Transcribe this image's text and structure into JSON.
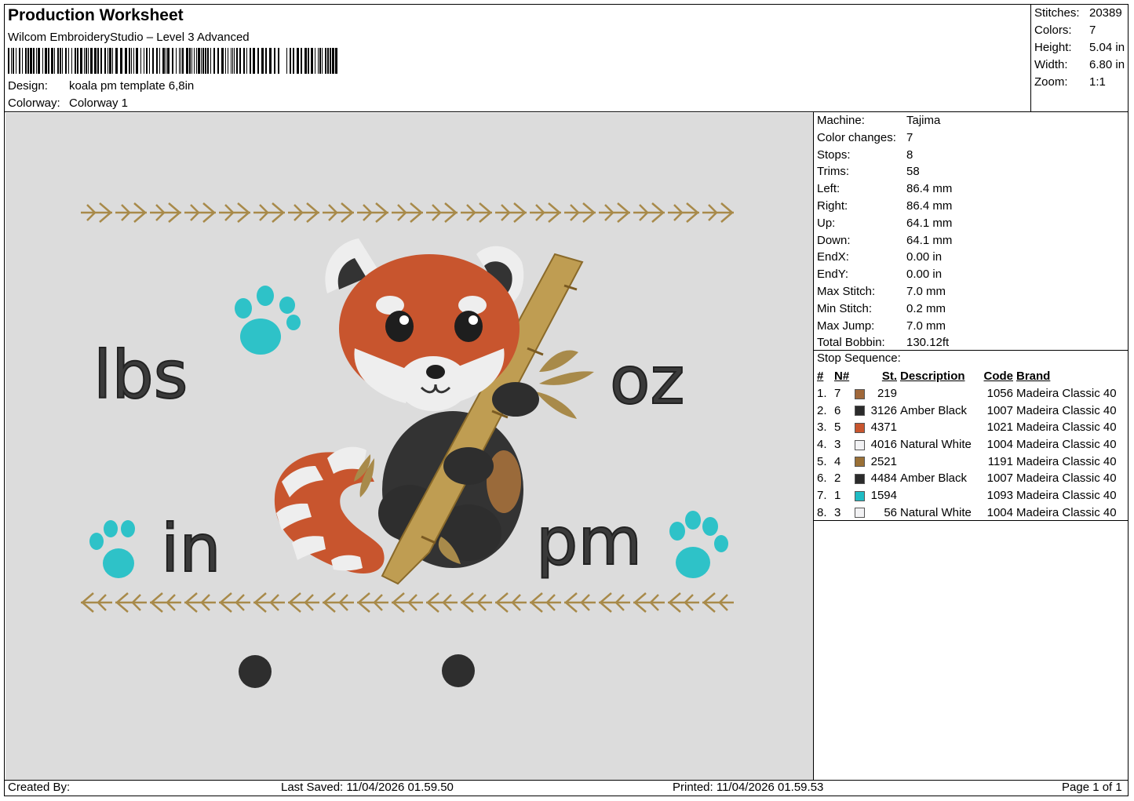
{
  "header": {
    "title": "Production Worksheet",
    "software": "Wilcom EmbroideryStudio – Level 3 Advanced",
    "design_label": "Design:",
    "design_value": "koala pm template 6,8in",
    "colorway_label": "Colorway:",
    "colorway_value": "Colorway 1"
  },
  "summary": [
    {
      "label": "Stitches:",
      "value": "20389"
    },
    {
      "label": "Colors:",
      "value": "7"
    },
    {
      "label": "Height:",
      "value": "5.04 in"
    },
    {
      "label": "Width:",
      "value": "6.80 in"
    },
    {
      "label": "Zoom:",
      "value": "1:1"
    }
  ],
  "machine_info": [
    {
      "label": "Machine:",
      "value": "Tajima"
    },
    {
      "label": "Color changes:",
      "value": "7"
    },
    {
      "label": "Stops:",
      "value": "8"
    },
    {
      "label": "Trims:",
      "value": "58"
    },
    {
      "label": "Left:",
      "value": "86.4 mm"
    },
    {
      "label": "Right:",
      "value": "86.4 mm"
    },
    {
      "label": "Up:",
      "value": "64.1 mm"
    },
    {
      "label": "Down:",
      "value": "64.1 mm"
    },
    {
      "label": "EndX:",
      "value": "0.00 in"
    },
    {
      "label": "EndY:",
      "value": "0.00 in"
    },
    {
      "label": "Max Stitch:",
      "value": "7.0 mm"
    },
    {
      "label": "Min Stitch:",
      "value": "0.2 mm"
    },
    {
      "label": "Max Jump:",
      "value": "7.0 mm"
    },
    {
      "label": "Total Bobbin:",
      "value": "130.12ft"
    }
  ],
  "stop_sequence": {
    "title": "Stop Sequence:",
    "headers": {
      "seq": "#",
      "n": "N#",
      "st": "St.",
      "desc": "Description",
      "code": "Code",
      "brand": "Brand"
    },
    "rows": [
      {
        "seq": "1.",
        "n": "7",
        "color": "#a0683a",
        "st": "219",
        "desc": "",
        "code": "1056",
        "brand": "Madeira Classic 40"
      },
      {
        "seq": "2.",
        "n": "6",
        "color": "#2b2b2b",
        "st": "3126",
        "desc": "Amber Black",
        "code": "1007",
        "brand": "Madeira Classic 40"
      },
      {
        "seq": "3.",
        "n": "5",
        "color": "#c8552e",
        "st": "4371",
        "desc": "",
        "code": "1021",
        "brand": "Madeira Classic 40"
      },
      {
        "seq": "4.",
        "n": "3",
        "color": "#f2f2f4",
        "st": "4016",
        "desc": "Natural White",
        "code": "1004",
        "brand": "Madeira Classic 40"
      },
      {
        "seq": "5.",
        "n": "4",
        "color": "#9a7036",
        "st": "2521",
        "desc": "",
        "code": "1191",
        "brand": "Madeira Classic 40"
      },
      {
        "seq": "6.",
        "n": "2",
        "color": "#2b2b2b",
        "st": "4484",
        "desc": "Amber Black",
        "code": "1007",
        "brand": "Madeira Classic 40"
      },
      {
        "seq": "7.",
        "n": "1",
        "color": "#1fbcc4",
        "st": "1594",
        "desc": "",
        "code": "1093",
        "brand": "Madeira Classic 40"
      },
      {
        "seq": "8.",
        "n": "3",
        "color": "#f2f2f4",
        "st": "56",
        "desc": "Natural White",
        "code": "1004",
        "brand": "Madeira Classic 40"
      }
    ]
  },
  "design": {
    "background_color": "#dcdcdc",
    "text_lbs": "lbs",
    "text_oz": "oz",
    "text_in": "in",
    "text_pm": "pm",
    "text_color": "#3a3a3a",
    "paw_color": "#2ec2c8",
    "arrow_color": "#a88a4a",
    "fur_color": "#c8552e",
    "white_color": "#f0f0f2",
    "dark_color": "#333333",
    "bamboo_color": "#bf9d52"
  },
  "footer": {
    "created_by": "Created By:",
    "last_saved": "Last Saved: 11/04/2026 01.59.50",
    "printed": "Printed: 11/04/2026 01.59.53",
    "page": "Page 1 of 1"
  }
}
